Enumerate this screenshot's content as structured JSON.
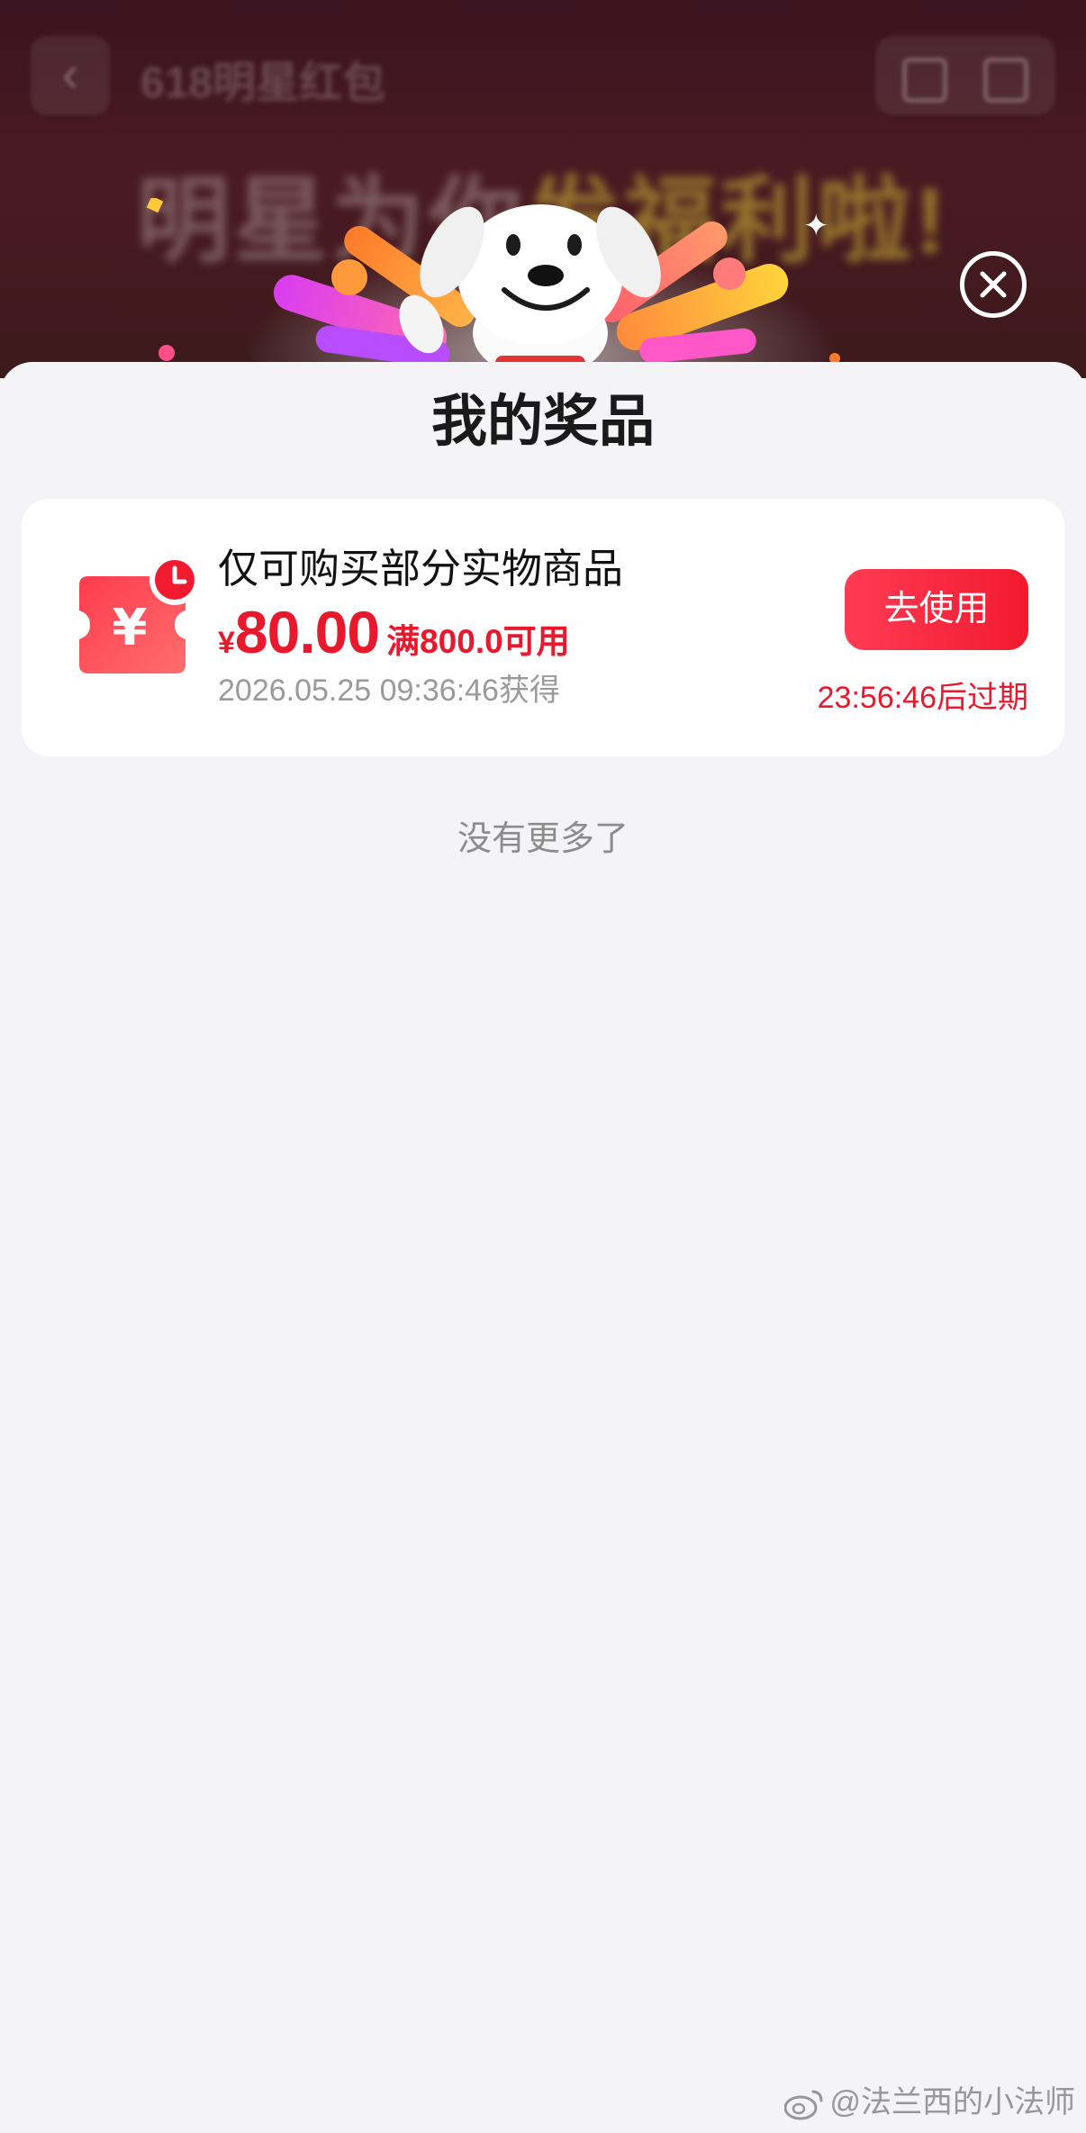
{
  "background_page": {
    "back_icon": "chevron-left-icon",
    "title": "618明星红包",
    "nav_icons": [
      "home-icon",
      "share-icon"
    ],
    "banner_text_white": "明星为你",
    "banner_text_highlight": "发福利啦!"
  },
  "modal": {
    "mascot": "joy-dog-mascot",
    "close_icon": "close-icon",
    "title": "我的奖品",
    "prizes": [
      {
        "icon": "coupon-clock-icon",
        "name": "仅可购买部分实物商品",
        "currency": "¥",
        "amount": "80.00",
        "condition": "满800.0可用",
        "obtained": "2026.05.25 09:36:46获得",
        "action_label": "去使用",
        "expire": "23:56:46后过期"
      }
    ],
    "end_text": "没有更多了"
  },
  "watermark": {
    "icon": "weibo-icon",
    "text": "@法兰西的小法师"
  },
  "colors": {
    "accent_red": "#e8192c",
    "button_gradient_start": "#ff3b54",
    "button_gradient_end": "#f21a2f",
    "sheet_bg": "#f4f4f6",
    "card_bg": "#ffffff"
  }
}
